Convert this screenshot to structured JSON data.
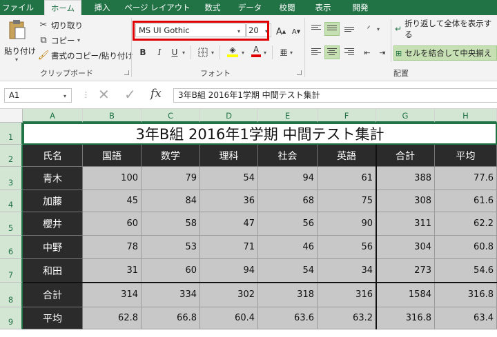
{
  "tabs": [
    "ファイル",
    "ホーム",
    "挿入",
    "ページ レイアウト",
    "数式",
    "データ",
    "校閲",
    "表示",
    "開発"
  ],
  "active_tab": "ホーム",
  "clipboard": {
    "paste": "貼り付け",
    "cut": "切り取り",
    "copy": "コピー",
    "format_painter": "書式のコピー/貼り付け",
    "group_label": "クリップボード"
  },
  "font": {
    "name": "MS UI Gothic",
    "size": "20",
    "grow": "A",
    "shrink": "A",
    "bold": "B",
    "italic": "I",
    "underline": "U",
    "font_color_letter": "A",
    "phonetic": "亜",
    "group_label": "フォント"
  },
  "alignment": {
    "wrap_text": "折り返して全体を表示する",
    "merge_center": "セルを結合して中央揃え",
    "group_label": "配置"
  },
  "formula_bar": {
    "name_box": "A1",
    "fx": "fx",
    "content": "3年B組 2016年1学期 中間テスト集計"
  },
  "columns": [
    "A",
    "B",
    "C",
    "D",
    "E",
    "F",
    "G",
    "H"
  ],
  "rows": [
    "1",
    "2",
    "3",
    "4",
    "5",
    "6",
    "7",
    "8",
    "9"
  ],
  "table": {
    "title": "3年B組 2016年1学期 中間テスト集計",
    "headers": [
      "氏名",
      "国語",
      "数学",
      "理科",
      "社会",
      "英語",
      "合計",
      "平均"
    ],
    "students": [
      {
        "name": "青木",
        "values": [
          "100",
          "79",
          "54",
          "94",
          "61",
          "388",
          "77.6"
        ]
      },
      {
        "name": "加藤",
        "values": [
          "45",
          "84",
          "36",
          "68",
          "75",
          "308",
          "61.6"
        ]
      },
      {
        "name": "櫻井",
        "values": [
          "60",
          "58",
          "47",
          "56",
          "90",
          "311",
          "62.2"
        ]
      },
      {
        "name": "中野",
        "values": [
          "78",
          "53",
          "71",
          "46",
          "56",
          "304",
          "60.8"
        ]
      },
      {
        "name": "和田",
        "values": [
          "31",
          "60",
          "94",
          "54",
          "34",
          "273",
          "54.6"
        ]
      }
    ],
    "summary": [
      {
        "name": "合計",
        "values": [
          "314",
          "334",
          "302",
          "318",
          "316",
          "1584",
          "316.8"
        ]
      },
      {
        "name": "平均",
        "values": [
          "62.8",
          "66.8",
          "60.4",
          "63.6",
          "63.2",
          "316.8",
          "63.4"
        ]
      }
    ]
  },
  "colors": {
    "excel_green": "#217346",
    "highlight_red": "#e00000",
    "header_fill": "#2b2b2b",
    "data_fill": "#c8c8c8"
  }
}
